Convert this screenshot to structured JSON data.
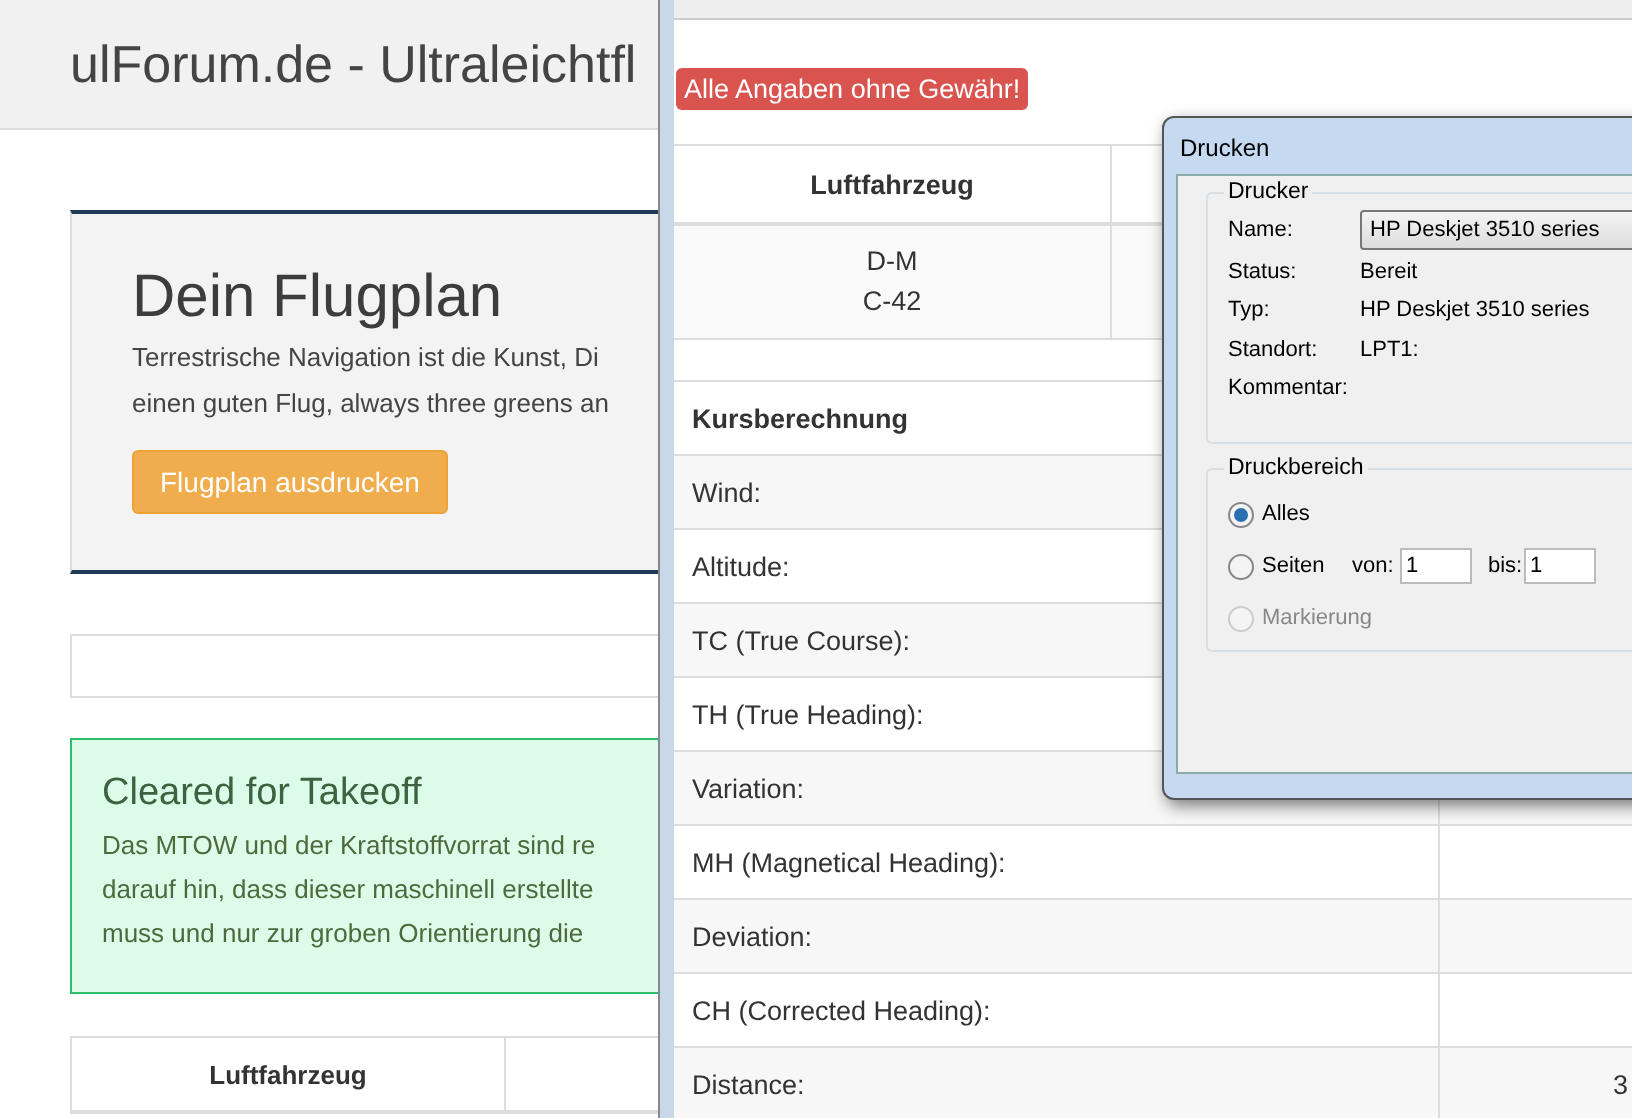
{
  "site": {
    "title": "ulForum.de - Ultraleichtfl"
  },
  "jumbotron": {
    "heading": "Dein Flugplan",
    "lines": [
      "Terrestrische Navigation ist die Kunst, Di",
      "einen guten Flug, always three greens an"
    ],
    "button": "Flugplan ausdrucken"
  },
  "alert": {
    "heading": "Cleared for Takeoff",
    "lines": [
      "Das MTOW und der Kraftstoffvorrat sind re",
      "darauf hin, dass dieser maschinell erstellte",
      "muss und nur zur groben Orientierung die"
    ]
  },
  "table": {
    "columns": [
      "Luftfahrzeug"
    ]
  },
  "print_preview": {
    "warning": "Alle Angaben ohne Gewähr!",
    "aircraft_table": {
      "columns": [
        "Luftfahrzeug"
      ],
      "rows": [
        [
          "D-M\nC-42"
        ]
      ]
    },
    "course_table": {
      "heading": "Kursberechnung",
      "rows": [
        {
          "label": "Wind:"
        },
        {
          "label": "Altitude:"
        },
        {
          "label": "TC (True Course):"
        },
        {
          "label": "TH (True Heading):"
        },
        {
          "label": "Variation:"
        },
        {
          "label": "MH (Magnetical Heading):"
        },
        {
          "label": "Deviation:"
        },
        {
          "label": "CH (Corrected Heading):"
        },
        {
          "label": "Distance:",
          "value": "3"
        }
      ]
    }
  },
  "print_dialog": {
    "title": "Drucken",
    "printer": {
      "legend": "Drucker",
      "name_label": "Name:",
      "name_value": "HP Deskjet 3510 series",
      "info": [
        {
          "label": "Status:",
          "value": "Bereit"
        },
        {
          "label": "Typ:",
          "value": "HP Deskjet 3510 series"
        },
        {
          "label": "Standort:",
          "value": "LPT1:"
        },
        {
          "label": "Kommentar:"
        }
      ]
    },
    "range": {
      "legend": "Druckbereich",
      "options": [
        {
          "kind": "plain",
          "label": "Alles",
          "selected": true,
          "disabled": false
        },
        {
          "kind": "pages",
          "label": "Seiten",
          "selected": false,
          "disabled": false
        },
        {
          "kind": "plain",
          "label": "Markierung",
          "selected": false,
          "disabled": true
        }
      ],
      "from": {
        "label": "von:",
        "value": "1"
      },
      "to": {
        "label": "bis:",
        "value": "1"
      }
    }
  }
}
